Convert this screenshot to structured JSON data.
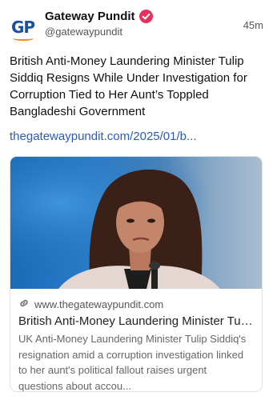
{
  "post": {
    "display_name": "Gateway Pundit",
    "handle": "@gatewaypundit",
    "time": "45m",
    "avatar_text": "GP",
    "text": "British Anti-Money Laundering Minister Tulip Siddiq Resigns While Under Investigation for Corruption Tied to Her Aunt’s Toppled Bangladeshi Government",
    "link_text": "thegatewaypundit.com/2025/01/b..."
  },
  "card": {
    "domain": "www.thegatewaypundit.com",
    "title": "British Anti-Money Laundering Minister Tulip Siddiq Resigns",
    "description": "UK Anti-Money Laundering Minister Tulip Siddiq's resignation amid a corruption investigation linked to her aunt's political fallout raises urgent questions about accou..."
  },
  "colors": {
    "brand_blue": "#1c4f9c",
    "brand_orange": "#e8862a",
    "verified_badge": "#e4325d",
    "link": "#2b5cb3"
  },
  "icons": {
    "verified": "verified-badge-icon",
    "link": "link-icon"
  }
}
